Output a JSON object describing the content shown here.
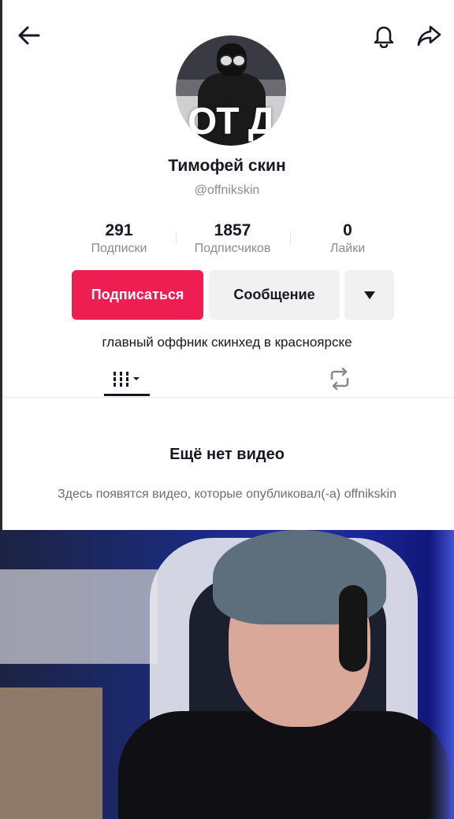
{
  "profile": {
    "display_name": "Тимофей скин",
    "username": "@offnikskin",
    "avatar_overlay_text": "ОТ Д",
    "bio": "главный оффник скинхед в красноярске"
  },
  "stats": [
    {
      "value": "291",
      "label": "Подписки"
    },
    {
      "value": "1857",
      "label": "Подписчиков"
    },
    {
      "value": "0",
      "label": "Лайки"
    }
  ],
  "actions": {
    "follow_label": "Подписаться",
    "message_label": "Сообщение",
    "more_icon": "caret-down-icon"
  },
  "tabs": [
    {
      "name": "videos",
      "icon": "grid-icon",
      "active": true
    },
    {
      "name": "reposts",
      "icon": "repost-icon",
      "active": false
    }
  ],
  "empty_state": {
    "title": "Ещё нет видео",
    "description": "Здесь появятся видео, которые опубликовал(-а) offnikskin"
  },
  "colors": {
    "accent": "#ee1d52",
    "text_primary": "#161823",
    "text_secondary": "#8a8b91",
    "button_secondary": "#f1f1f2"
  },
  "icons": {
    "back": "back-arrow-icon",
    "notifications": "bell-icon",
    "share": "share-arrow-icon"
  }
}
